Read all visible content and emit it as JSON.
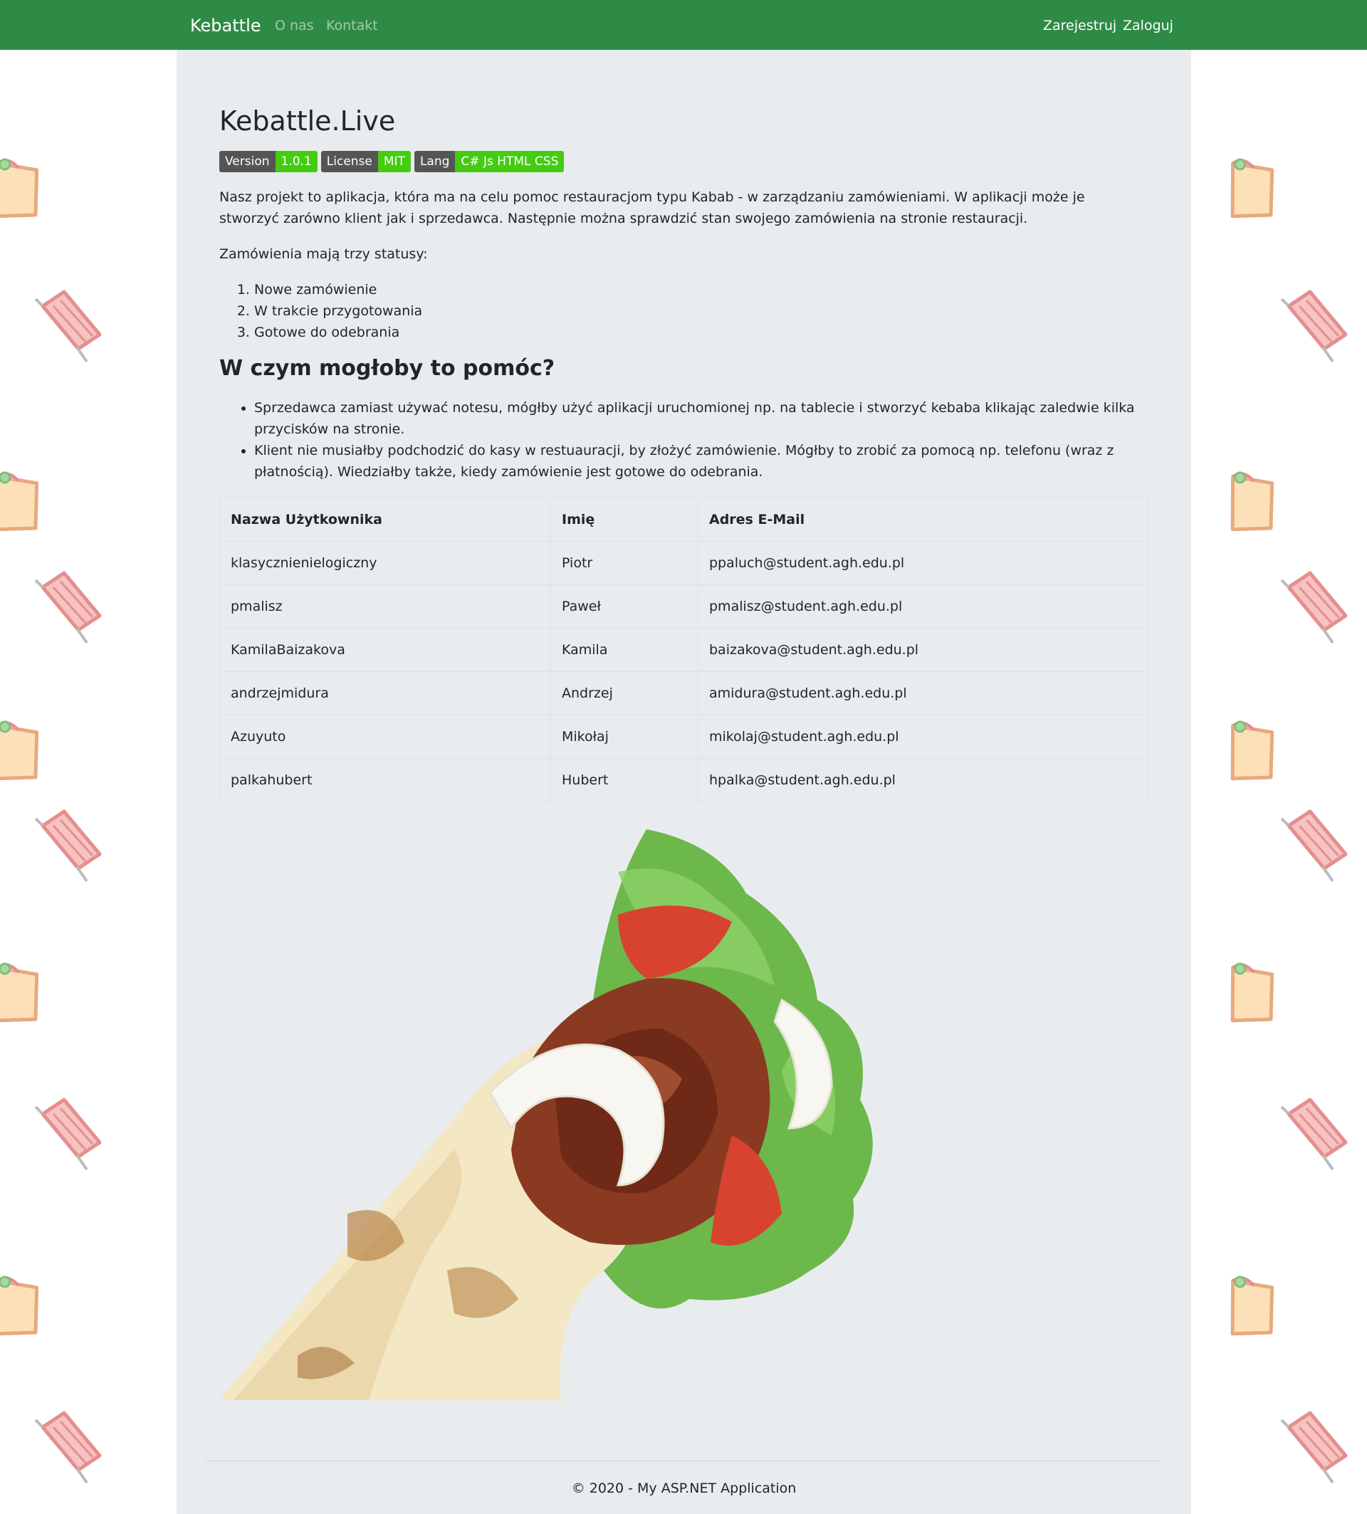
{
  "navbar": {
    "brand": "Kebattle",
    "links": [
      "O nas",
      "Kontakt"
    ],
    "auth": [
      "Zarejestruj",
      "Zaloguj"
    ],
    "color": "#2e8b45"
  },
  "main": {
    "title": "Kebattle.Live",
    "badges": [
      {
        "key": "Version",
        "value": "1.0.1"
      },
      {
        "key": "License",
        "value": "MIT"
      },
      {
        "key": "Lang",
        "value": "C# Js HTML CSS"
      }
    ],
    "intro": "Nasz projekt to aplikacja, która ma na celu pomoc restauracjom typu Kabab - w zarządzaniu zamówieniami. W aplikacji może je stworzyć zarówno klient jak i sprzedawca. Następnie można sprawdzić stan swojego zamówienia na stronie restauracji.",
    "statuses_label": "Zamówienia mają trzy statusy:",
    "statuses": [
      "Nowe zamówienie",
      "W trakcie przygotowania",
      "Gotowe do odebrania"
    ],
    "section_title": "W czym mogłoby to pomóc?",
    "benefits": [
      "Sprzedawca zamiast używać notesu, mógłby użyć aplikacji uruchomionej np. na tablecie i stworzyć kebaba klikając zaledwie kilka przycisków na stronie.",
      "Klient nie musiałby podchodzić do kasy w restuauracji, by złożyć zamówienie. Mógłby to zrobić za pomocą np. telefonu (wraz z płatnością). Wiedziałby także, kiedy zamówienie jest gotowe do odebrania."
    ],
    "table": {
      "headers": [
        "Nazwa Użytkownika",
        "Imię",
        "Adres E-Mail"
      ],
      "rows": [
        [
          "klasycznienielogiczny",
          "Piotr",
          "ppaluch@student.agh.edu.pl"
        ],
        [
          "pmalisz",
          "Paweł",
          "pmalisz@student.agh.edu.pl"
        ],
        [
          "KamilaBaizakova",
          "Kamila",
          "baizakova@student.agh.edu.pl"
        ],
        [
          "andrzejmidura",
          "Andrzej",
          "amidura@student.agh.edu.pl"
        ],
        [
          "Azuyuto",
          "Mikołaj",
          "mikolaj@student.agh.edu.pl"
        ],
        [
          "palkahubert",
          "Hubert",
          "hpalka@student.agh.edu.pl"
        ]
      ]
    },
    "image_icon": "kebab-wrap-photo"
  },
  "footer": {
    "text": "© 2020 - My ASP.NET Application"
  }
}
